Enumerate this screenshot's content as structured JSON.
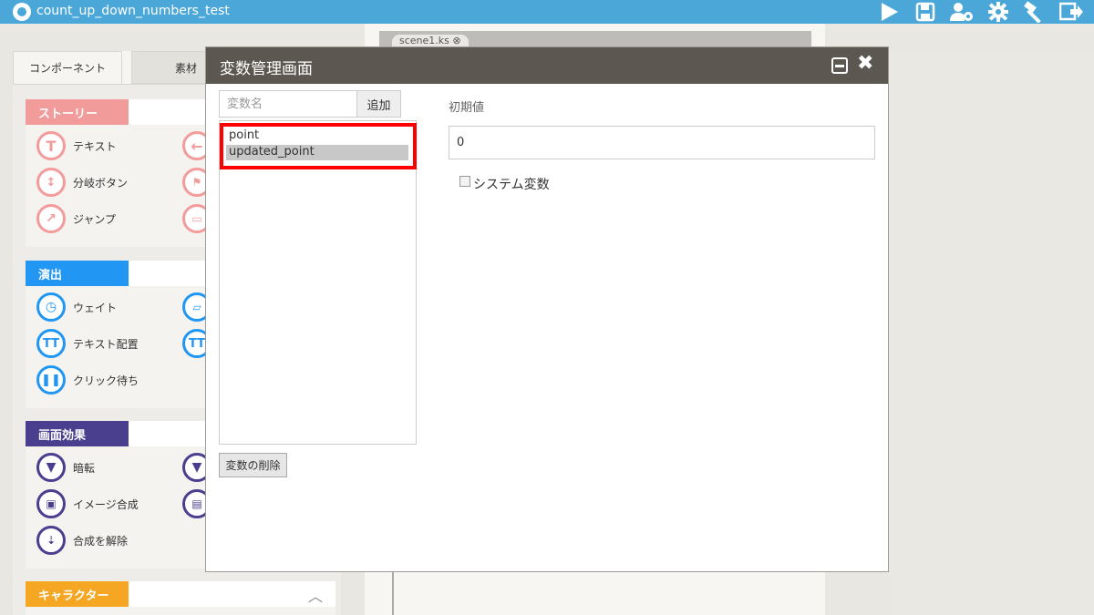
{
  "app": {
    "title": "count_up_down_numbers_test"
  },
  "toolbar": {
    "icons": [
      "play-icon",
      "save-icon",
      "user-settings-icon",
      "gear-icon",
      "build-icon",
      "exit-icon"
    ]
  },
  "left_panel": {
    "tabs": [
      {
        "label": "コンポーネント"
      },
      {
        "label": "素材"
      }
    ],
    "sections": [
      {
        "label": "ストーリー",
        "color": "#f29b9b",
        "items": [
          "テキスト",
          "分岐ボタン",
          "ジャンプ"
        ]
      },
      {
        "label": "演出",
        "color": "#2196f3",
        "items": [
          "ウェイト",
          "テキスト配置",
          "クリック待ち"
        ]
      },
      {
        "label": "画面効果",
        "color": "#4a3f8f",
        "items": [
          "暗転",
          "イメージ合成",
          "合成を解除"
        ]
      },
      {
        "label": "キャラクター",
        "color": "#f5a623",
        "items": []
      }
    ]
  },
  "editor": {
    "scene_tab": "scene1.ks"
  },
  "modal": {
    "title": "変数管理画面",
    "var_name_placeholder": "変数名",
    "add_label": "追加",
    "variables": [
      "point",
      "updated_point"
    ],
    "selected_index": 1,
    "delete_label": "変数の削除",
    "initial_value_label": "初期値",
    "initial_value": "0",
    "system_var_label": "システム変数"
  }
}
